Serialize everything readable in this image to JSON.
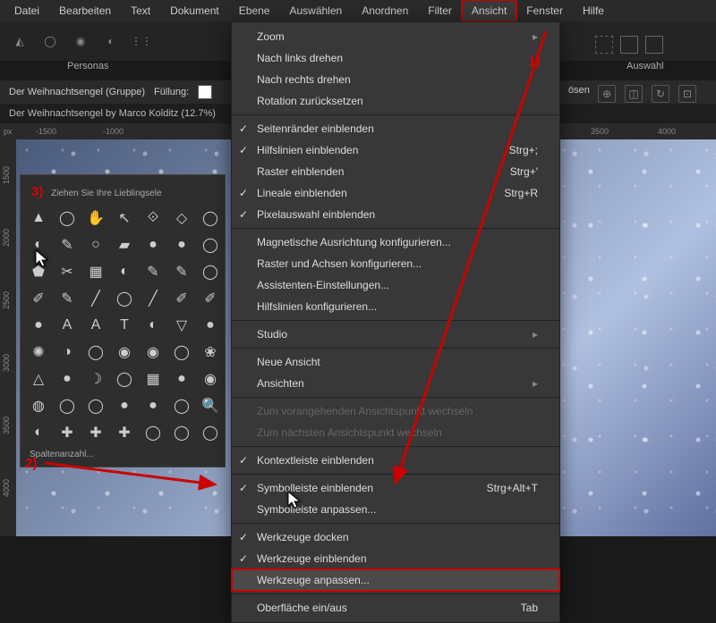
{
  "menubar": [
    "Datei",
    "Bearbeiten",
    "Text",
    "Dokument",
    "Ebene",
    "Auswählen",
    "Anordnen",
    "Filter",
    "Ansicht",
    "Fenster",
    "Hilfe"
  ],
  "menubar_active_index": 8,
  "personas_label": "Personas",
  "auswahl_label": "Auswahl",
  "contextbar": {
    "layer_name": "Der Weihnachtsengel (Gruppe)",
    "fill_label": "Füllung:"
  },
  "losen_text": "ösen",
  "tab_title": "Der Weihnachtsengel by Marco Kolditz (12.7%)",
  "ruler_h_marks": [
    {
      "pos": 40,
      "label": "-1500"
    },
    {
      "pos": 115,
      "label": "-1000"
    },
    {
      "pos": 660,
      "label": "3500"
    },
    {
      "pos": 735,
      "label": "4000"
    }
  ],
  "ruler_h_unit": "px",
  "ruler_v_marks": [
    {
      "pos": 30,
      "label": "1500"
    },
    {
      "pos": 100,
      "label": "2000"
    },
    {
      "pos": 170,
      "label": "2500"
    },
    {
      "pos": 240,
      "label": "3000"
    },
    {
      "pos": 310,
      "label": "3500"
    },
    {
      "pos": 380,
      "label": "4000"
    }
  ],
  "tool_palette": {
    "header": "Ziehen Sie Ihre Lieblingsele",
    "footer": "Spaltenanzahl...",
    "annotation_num": "3)",
    "tools": [
      "▲",
      "◯",
      "✋",
      "↖",
      "⟐",
      "◇",
      "◯",
      "◐",
      "✎",
      "○",
      "▰",
      "●",
      "●",
      "◯",
      "⬟",
      "✂",
      "▦",
      "◐",
      "✎",
      "✎",
      "◯",
      "✐",
      "✎",
      "╱",
      "◯",
      "╱",
      "✐",
      "✐",
      "●",
      "A",
      "A",
      "T",
      "◐",
      "▽",
      "●",
      "✺",
      "◑",
      "◯",
      "◉",
      "◉",
      "◯",
      "❀",
      "△",
      "●",
      "☽",
      "◯",
      "▦",
      "●",
      "◉",
      "◍",
      "◯",
      "◯",
      "●",
      "●",
      "◯",
      "🔍",
      "◐",
      "✚",
      "✚",
      "✚",
      "◯",
      "◯",
      "◯"
    ]
  },
  "dropdown": [
    {
      "type": "item",
      "label": "Zoom",
      "arrow": true
    },
    {
      "type": "item",
      "label": "Nach links drehen"
    },
    {
      "type": "item",
      "label": "Nach rechts drehen"
    },
    {
      "type": "item",
      "label": "Rotation zurücksetzen"
    },
    {
      "type": "sep"
    },
    {
      "type": "item",
      "label": "Seitenränder einblenden",
      "check": true
    },
    {
      "type": "item",
      "label": "Hilfslinien einblenden",
      "check": true,
      "shortcut": "Strg+;"
    },
    {
      "type": "item",
      "label": "Raster einblenden",
      "shortcut": "Strg+'"
    },
    {
      "type": "item",
      "label": "Lineale einblenden",
      "check": true,
      "shortcut": "Strg+R"
    },
    {
      "type": "item",
      "label": "Pixelauswahl einblenden",
      "check": true
    },
    {
      "type": "sep"
    },
    {
      "type": "item",
      "label": "Magnetische Ausrichtung konfigurieren..."
    },
    {
      "type": "item",
      "label": "Raster und Achsen konfigurieren..."
    },
    {
      "type": "item",
      "label": "Assistenten-Einstellungen..."
    },
    {
      "type": "item",
      "label": "Hilfslinien konfigurieren..."
    },
    {
      "type": "sep"
    },
    {
      "type": "item",
      "label": "Studio",
      "arrow": true
    },
    {
      "type": "sep"
    },
    {
      "type": "item",
      "label": "Neue Ansicht"
    },
    {
      "type": "item",
      "label": "Ansichten",
      "arrow": true
    },
    {
      "type": "sep"
    },
    {
      "type": "item",
      "label": "Zum vorangehenden Ansichtspunkt wechseln",
      "disabled": true
    },
    {
      "type": "item",
      "label": "Zum nächsten Ansichtspunkt wechseln",
      "disabled": true
    },
    {
      "type": "sep"
    },
    {
      "type": "item",
      "label": "Kontextleiste einblenden",
      "check": true
    },
    {
      "type": "sep"
    },
    {
      "type": "item",
      "label": "Symbolleiste einblenden",
      "check": true,
      "shortcut": "Strg+Alt+T"
    },
    {
      "type": "item",
      "label": "Symbolleiste anpassen..."
    },
    {
      "type": "sep"
    },
    {
      "type": "item",
      "label": "Werkzeuge docken",
      "check": true
    },
    {
      "type": "item",
      "label": "Werkzeuge einblenden",
      "check": true
    },
    {
      "type": "item",
      "label": "Werkzeuge anpassen...",
      "highlight": true
    },
    {
      "type": "sep"
    },
    {
      "type": "item",
      "label": "Oberfläche ein/aus",
      "shortcut": "Tab"
    }
  ],
  "annotations": {
    "a1": "1)",
    "a2": "2)"
  }
}
